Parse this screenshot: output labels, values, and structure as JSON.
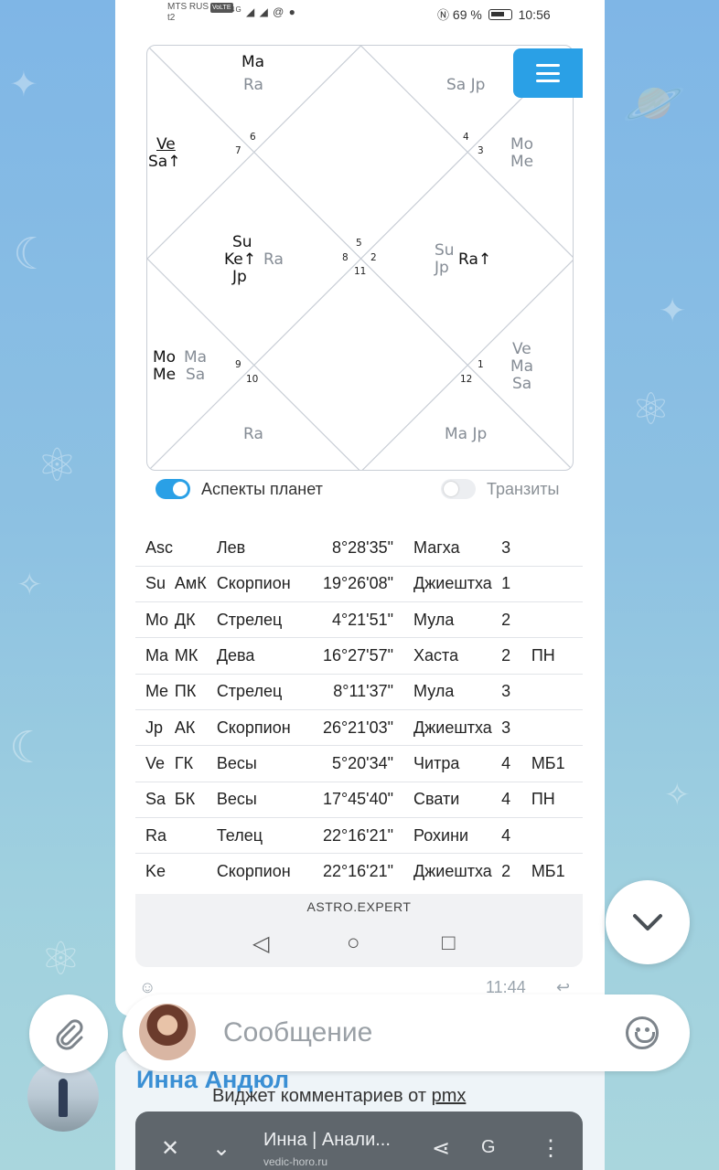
{
  "status_bar": {
    "carrier": "MTS RUS",
    "volte": "VoLTE",
    "carrier2": "t2",
    "signal": "4G",
    "icons": "◢ ◢ @ ●",
    "battery_percent": "69 %",
    "time": "10:56"
  },
  "chart": {
    "house_numbers": [
      "5",
      "2",
      "11",
      "8",
      "4",
      "3",
      "6",
      "7",
      "9",
      "10",
      "12",
      "1"
    ],
    "planets": {
      "top_left_dark": "Ma",
      "top_left_gray": "Ra",
      "top_right_gray": "Sa Jp",
      "left_upper_1": "Ve",
      "left_upper_2": "Sa↑",
      "right_upper_1": "Mo",
      "right_upper_2": "Me",
      "center_left_1": "Su",
      "center_left_2": "Ke↑",
      "center_left_3": "Jp",
      "center_left_gray": "Ra",
      "center_right_gray_1": "Su",
      "center_right_gray_2": "Jp",
      "center_right_dark": "Ra↑",
      "left_lower_dark_1": "Mo",
      "left_lower_dark_2": "Me",
      "left_lower_gray_1": "Ma",
      "left_lower_gray_2": "Sa",
      "right_lower_1": "Ve",
      "right_lower_2": "Ma",
      "right_lower_3": "Sa",
      "bottom_left_gray": "Ra",
      "bottom_right_gray": "Ma Jp"
    }
  },
  "toggles": {
    "aspects": {
      "label": "Аспекты планет",
      "on": true
    },
    "transits": {
      "label": "Транзиты",
      "on": false
    }
  },
  "planet_table": [
    [
      "Asc",
      "",
      "Лев",
      "8°28'35\"",
      "Магха",
      "3",
      ""
    ],
    [
      "Su",
      "АмК",
      "Скорпион",
      "19°26'08\"",
      "Джиештха",
      "1",
      ""
    ],
    [
      "Mo",
      "ДК",
      "Стрелец",
      "4°21'51\"",
      "Мула",
      "2",
      ""
    ],
    [
      "Ma",
      "МК",
      "Дева",
      "16°27'57\"",
      "Хаста",
      "2",
      "ПН"
    ],
    [
      "Me",
      "ПК",
      "Стрелец",
      "8°11'37\"",
      "Мула",
      "3",
      ""
    ],
    [
      "Jp",
      "АК",
      "Скорпион",
      "26°21'03\"",
      "Джиештха",
      "3",
      ""
    ],
    [
      "Ve",
      "ГК",
      "Весы",
      "5°20'34\"",
      "Читра",
      "4",
      "МБ1"
    ],
    [
      "Sa",
      "БК",
      "Весы",
      "17°45'40\"",
      "Свати",
      "4",
      "ПН"
    ],
    [
      "Ra",
      "",
      "Телец",
      "22°16'21\"",
      "Рохини",
      "4",
      ""
    ],
    [
      "Ke",
      "",
      "Скорпион",
      "22°16'21\"",
      "Джиештха",
      "2",
      "МБ1"
    ]
  ],
  "browser": {
    "url": "ASTRO.EXPERT"
  },
  "message_meta": {
    "time": "11:44"
  },
  "composer": {
    "placeholder": "Сообщение"
  },
  "next_message": {
    "author": "Инна Андюл",
    "widget_prefix": "Виджет комментариев от",
    "widget_link": "pmx",
    "bar_title": "Инна | Анали...",
    "bar_subtitle": "vedic-horo.ru"
  },
  "colors": {
    "accent": "#2aa0e6",
    "author": "#3a8fd4"
  }
}
